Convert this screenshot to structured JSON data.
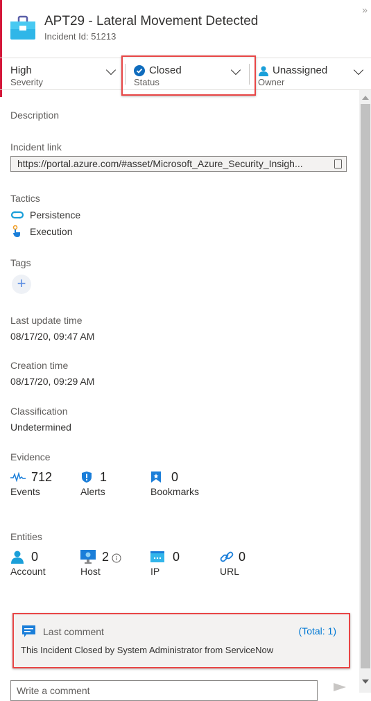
{
  "header": {
    "title": "APT29 - Lateral Movement Detected",
    "incident_id": "Incident Id: 51213",
    "expand_icon": "double-chevron-right-icon"
  },
  "properties": {
    "severity": {
      "value": "High",
      "label": "Severity"
    },
    "status": {
      "value": "Closed",
      "label": "Status"
    },
    "owner": {
      "value": "Unassigned",
      "label": "Owner"
    }
  },
  "details": {
    "description_label": "Description",
    "incident_link_label": "Incident link",
    "incident_link_value": "https://portal.azure.com/#asset/Microsoft_Azure_Security_Insigh...",
    "tactics_label": "Tactics",
    "tactics": [
      "Persistence",
      "Execution"
    ],
    "tags_label": "Tags",
    "add_tag": "+",
    "last_update_label": "Last update time",
    "last_update_value": "08/17/20, 09:47 AM",
    "creation_label": "Creation time",
    "creation_value": "08/17/20, 09:29 AM",
    "classification_label": "Classification",
    "classification_value": "Undetermined"
  },
  "evidence": {
    "label": "Evidence",
    "items": [
      {
        "count": "712",
        "name": "Events"
      },
      {
        "count": "1",
        "name": "Alerts"
      },
      {
        "count": "0",
        "name": "Bookmarks"
      }
    ]
  },
  "entities": {
    "label": "Entities",
    "items": [
      {
        "count": "0",
        "name": "Account"
      },
      {
        "count": "2",
        "name": "Host"
      },
      {
        "count": "0",
        "name": "IP"
      },
      {
        "count": "0",
        "name": "URL"
      }
    ]
  },
  "comments": {
    "title": "Last comment",
    "total": "(Total: 1)",
    "last_comment": "This Incident Closed by System Administrator from ServiceNow",
    "input_placeholder": "Write a comment"
  },
  "colors": {
    "accent": "#d4173a",
    "highlight": "#e84545",
    "link": "#0078d4",
    "icon_blue": "#1a9fd9"
  }
}
